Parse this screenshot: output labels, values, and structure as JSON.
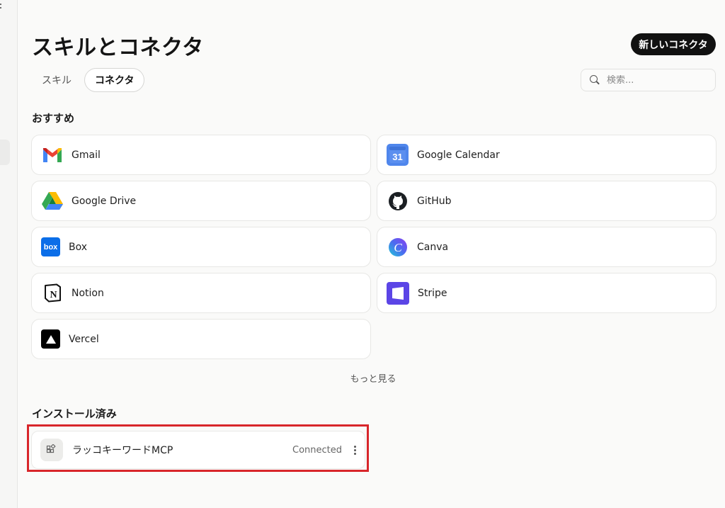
{
  "header": {
    "title": "スキルとコネクタ",
    "new_button_label": "新しいコネクタ"
  },
  "tabs": [
    {
      "label": "スキル",
      "active": false
    },
    {
      "label": "コネクタ",
      "active": true
    }
  ],
  "search": {
    "placeholder": "検索...",
    "value": ""
  },
  "recommended": {
    "title": "おすすめ",
    "items": [
      {
        "label": "Gmail",
        "icon": "gmail-icon"
      },
      {
        "label": "Google Calendar",
        "icon": "google-calendar-icon"
      },
      {
        "label": "Google Drive",
        "icon": "google-drive-icon"
      },
      {
        "label": "GitHub",
        "icon": "github-icon"
      },
      {
        "label": "Box",
        "icon": "box-icon"
      },
      {
        "label": "Canva",
        "icon": "canva-icon"
      },
      {
        "label": "Notion",
        "icon": "notion-icon"
      },
      {
        "label": "Stripe",
        "icon": "stripe-icon"
      },
      {
        "label": "Vercel",
        "icon": "vercel-icon"
      }
    ],
    "more_label": "もっと見る",
    "calendar_day": "31",
    "box_text": "box",
    "canva_text": "C",
    "notion_text": "N"
  },
  "installed": {
    "title": "インストール済み",
    "items": [
      {
        "label": "ラッコキーワードMCP",
        "status": "Connected",
        "icon": "connector-icon"
      }
    ]
  },
  "colors": {
    "highlight": "#d8262b",
    "primary_button": "#111111"
  }
}
